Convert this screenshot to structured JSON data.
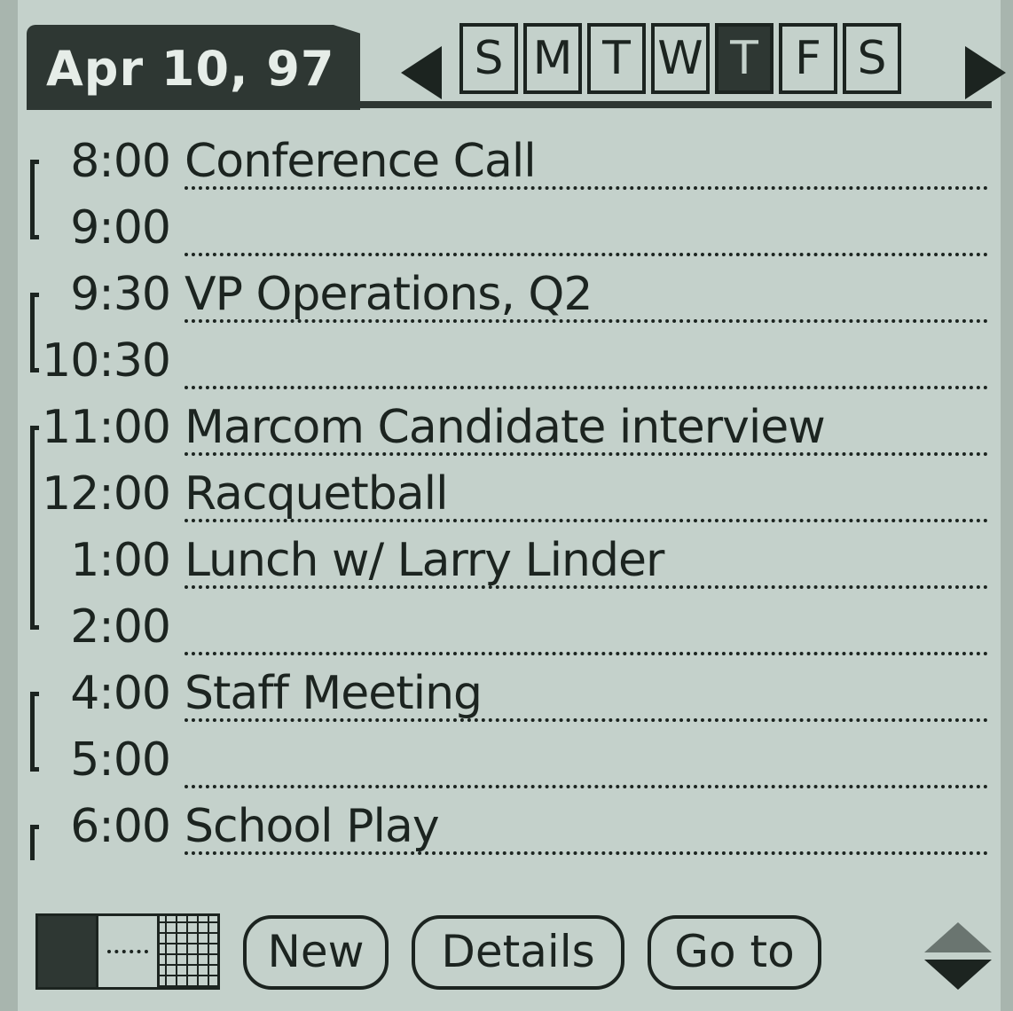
{
  "header": {
    "date": "Apr 10, 97",
    "days": [
      "S",
      "M",
      "T",
      "W",
      "T",
      "F",
      "S"
    ],
    "selected_day_index": 4
  },
  "agenda": [
    {
      "time": "8:00",
      "event": "Conference Call"
    },
    {
      "time": "9:00",
      "event": ""
    },
    {
      "time": "9:30",
      "event": "VP Operations, Q2"
    },
    {
      "time": "10:30",
      "event": ""
    },
    {
      "time": "11:00",
      "event": "Marcom Candidate interview"
    },
    {
      "time": "12:00",
      "event": "Racquetball"
    },
    {
      "time": "1:00",
      "event": "Lunch w/ Larry Linder"
    },
    {
      "time": "2:00",
      "event": ""
    },
    {
      "time": "4:00",
      "event": "Staff Meeting"
    },
    {
      "time": "5:00",
      "event": ""
    },
    {
      "time": "6:00",
      "event": "School Play"
    }
  ],
  "toolbar": {
    "new_label": "New",
    "details_label": "Details",
    "goto_label": "Go to"
  }
}
